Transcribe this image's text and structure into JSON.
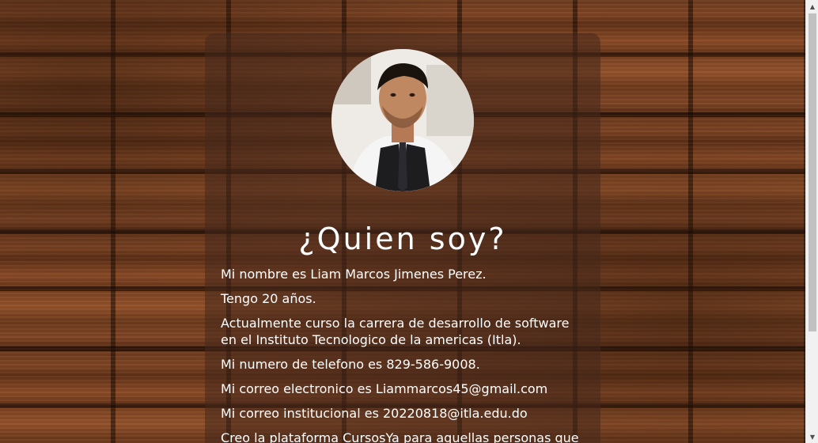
{
  "page": {
    "title": "¿Quien soy?"
  },
  "profile": {
    "photo_icon": "profile-photo"
  },
  "info": {
    "lines": [
      "Mi nombre es Liam Marcos Jimenes Perez.",
      "Tengo 20 años.",
      "Actualmente curso la carrera de desarrollo de software en el Instituto Tecnologico de la americas (Itla).",
      "Mi numero de telefono es 829-586-9008.",
      "Mi correo electronico es Liammarcos45@gmail.com",
      "Mi correo institucional es 20220818@itla.edu.do",
      "Creo la plataforma CursosYa para aquellas personas que"
    ]
  },
  "scrollbar": {
    "up_icon": "▲",
    "down_icon": "▼"
  },
  "colors": {
    "card_background": "#46281c",
    "text": "#ffffff",
    "wood": "#7d4424"
  }
}
